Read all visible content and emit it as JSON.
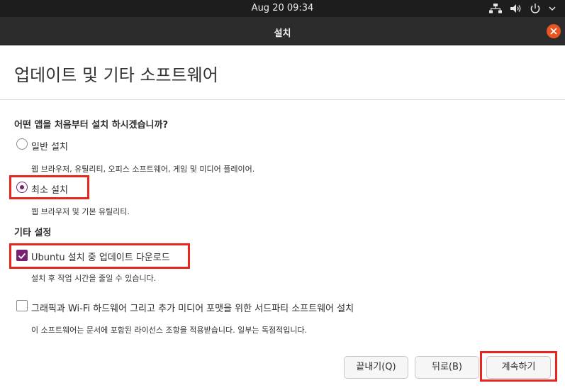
{
  "topbar": {
    "clock": "Aug 20  09:34",
    "icons": [
      "network-icon",
      "volume-icon",
      "power-icon",
      "chevron-down-icon"
    ]
  },
  "window": {
    "title": "설치",
    "close_icon": "close-icon"
  },
  "page": {
    "heading": "업데이트 및 기타 소프트웨어",
    "question": "어떤 앱을 처음부터 설치 하시겠습니까?",
    "install_options": [
      {
        "label": "일반 설치",
        "description": "웹 브라우저, 유틸리티, 오피스  소프트웨어, 게임 및 미디어 플레이어.",
        "selected": false
      },
      {
        "label": "최소 설치",
        "description": "웹 브라우저 및 기본 유틸리티.",
        "selected": true
      }
    ],
    "other_section_title": "기타 설정",
    "other_options": [
      {
        "label": "Ubuntu 설치 중 업데이트 다운로드",
        "description": "설치 후 작업 시간을 줄일 수 있습니다.",
        "checked": true
      },
      {
        "label": "그래픽과 Wi-Fi 하드웨어 그리고 추가 미디어 포맷을 위한 서드파티 소프트웨어 설치",
        "description": "이 소프트웨어는 문서에 포함된 라이선스 조항을 적용받습니다. 일부는 독점적입니다.",
        "checked": false
      }
    ]
  },
  "buttons": {
    "quit": "끝내기(Q)",
    "back": "뒤로(B)",
    "continue": "계속하기"
  },
  "colors": {
    "accent": "#77216f",
    "close": "#e95420",
    "highlight": "#e9261d",
    "topbar": "#1d1d1d",
    "titlebar": "#2c2c2c"
  }
}
